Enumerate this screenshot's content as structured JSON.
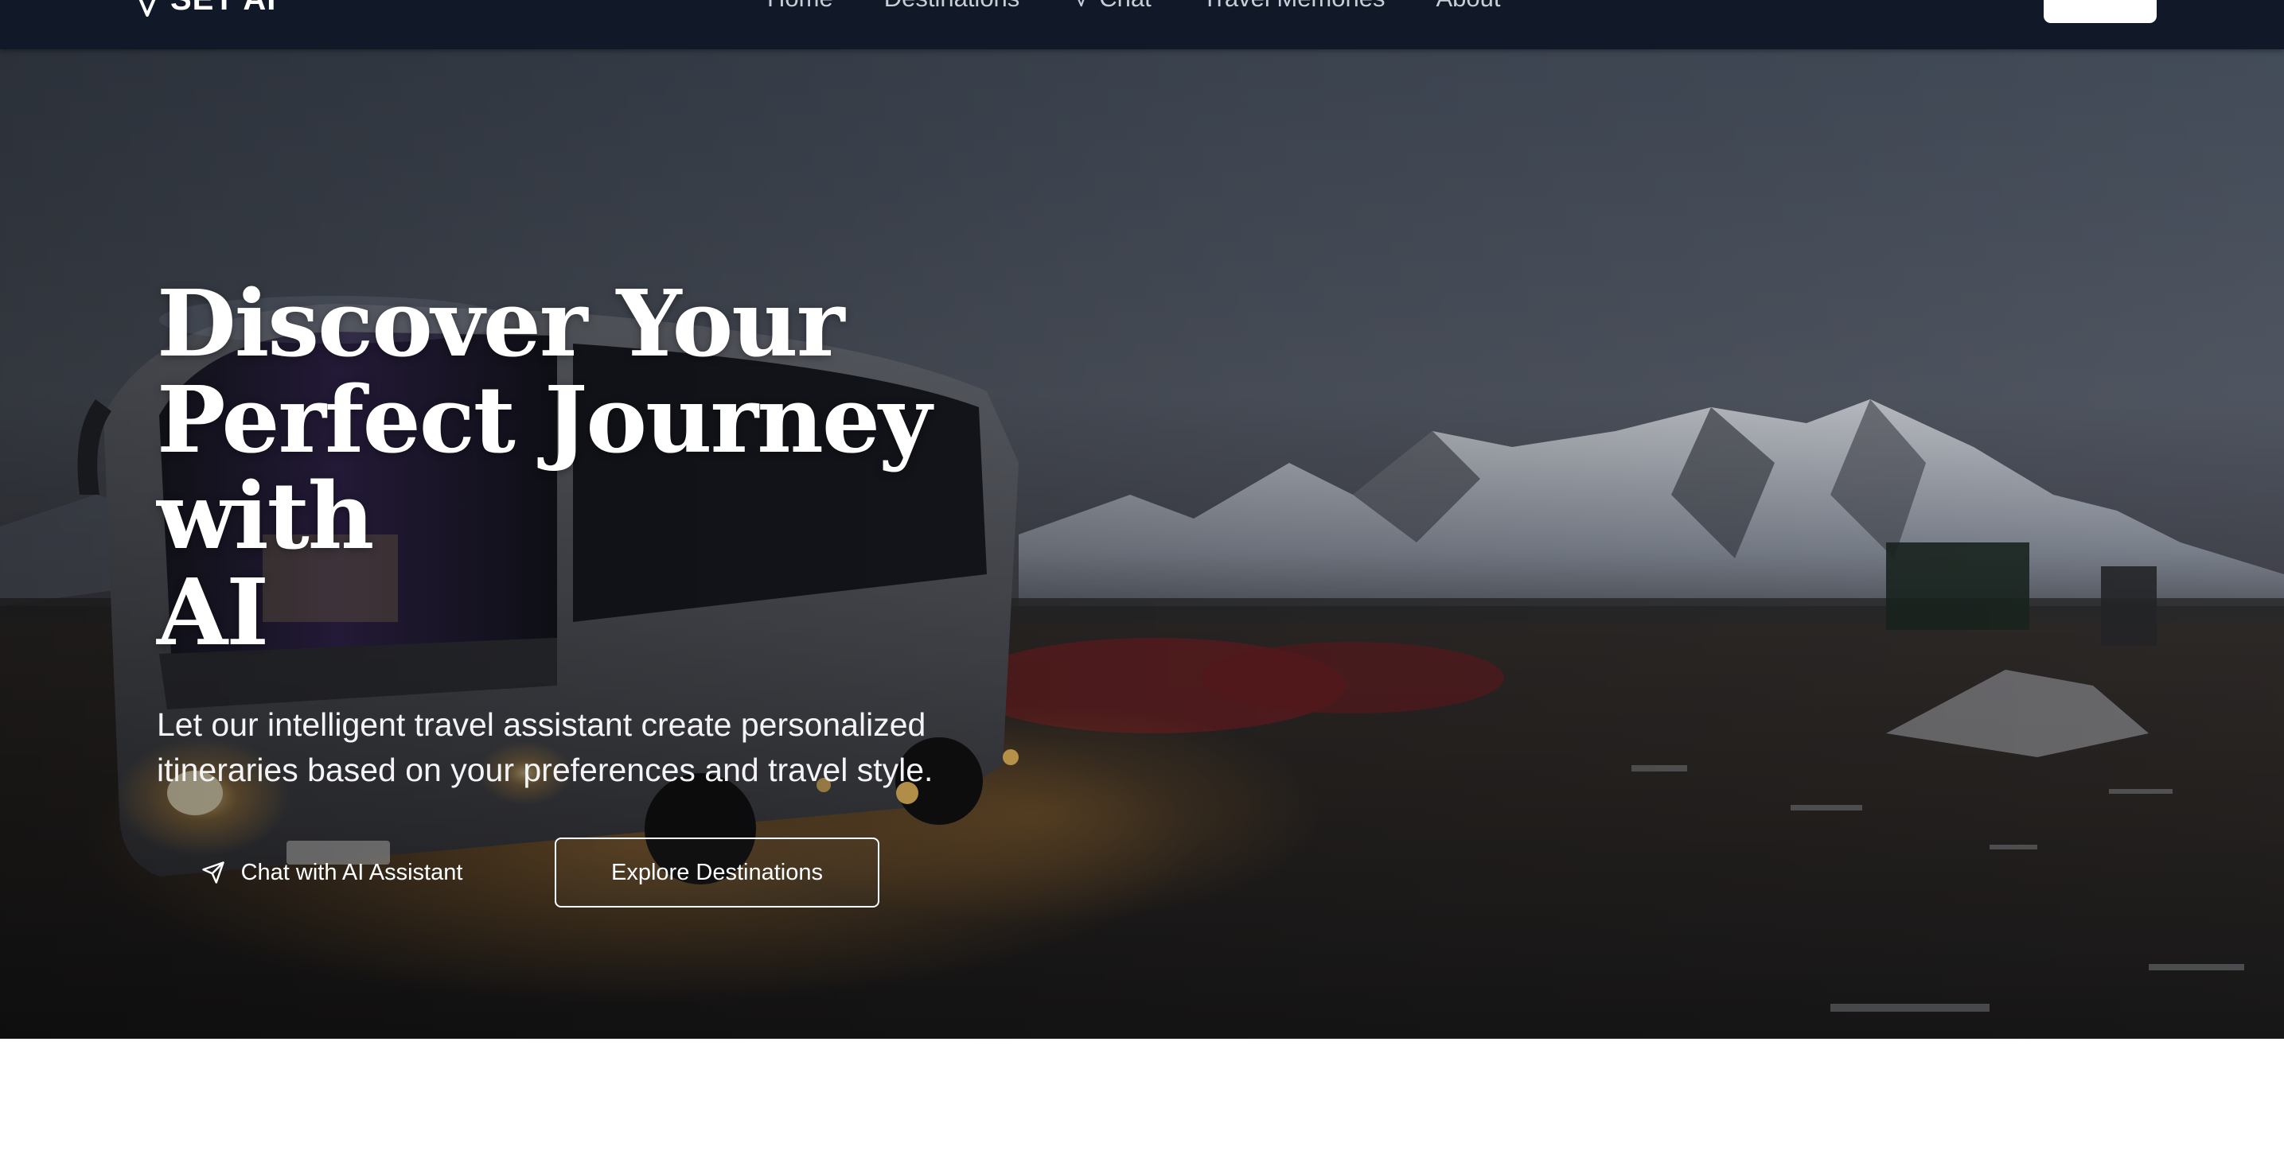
{
  "nav": {
    "brand": "SET AI",
    "links": [
      {
        "label": "Home"
      },
      {
        "label": "Destinations"
      },
      {
        "label": "Chat"
      },
      {
        "label": "Travel Memories"
      },
      {
        "label": "About"
      }
    ],
    "cta_label": ""
  },
  "hero": {
    "title_line1": "Discover Your",
    "title_line2": "Perfect Journey with",
    "title_line3": "AI",
    "subtitle_line1": "Let our intelligent travel assistant create personalized",
    "subtitle_line2": "itineraries based on your preferences and travel style.",
    "primary_button": "Chat with AI Assistant",
    "secondary_button": "Explore Destinations",
    "background_image": "night-bus-mountain-landscape"
  },
  "colors": {
    "navbar": "#111827",
    "text_on_dark": "#ffffff",
    "nav_link": "#c9cdd6",
    "page_background": "#ffffff"
  }
}
